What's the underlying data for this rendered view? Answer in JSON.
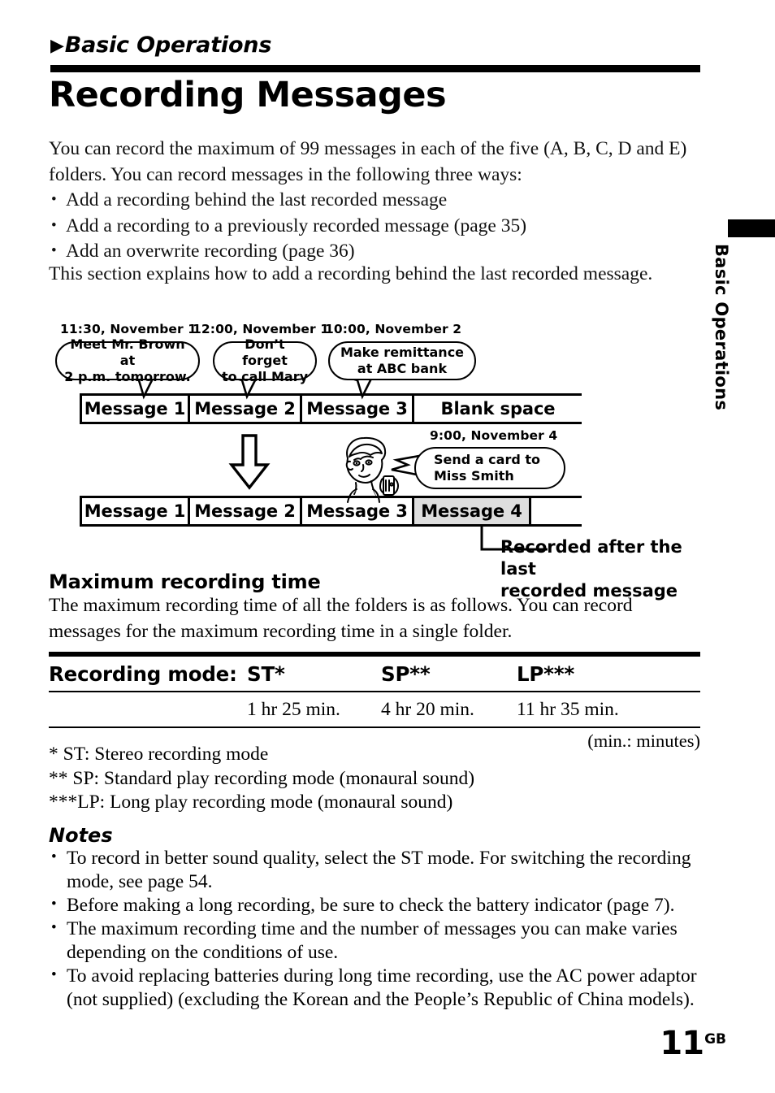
{
  "chapter": {
    "marker": "▶",
    "label": "Basic Operations"
  },
  "title": "Recording Messages",
  "side_tab": {
    "label": "Basic Operations"
  },
  "intro": {
    "paragraph": "You can record the maximum of 99 messages in each of the five (A, B, C, D and E) folders.  You can record messages in the following three ways:",
    "bullets": [
      "Add a recording behind the last recorded message",
      "Add a recording to a previously recorded message (page 35)",
      "Add an overwrite recording  (page 36)"
    ]
  },
  "section_intro": "This section explains how to add a recording behind the last recorded message.",
  "diagram": {
    "timestamps_top": [
      "11:30,  November 1",
      "12:00,  November 1",
      "10:00,  November 2"
    ],
    "bubbles_top": [
      "Meet Mr. Brown at\n2 p.m. tomorrow.",
      "Don’t forget\nto call Mary",
      "Make remittance\nat ABC bank"
    ],
    "strip_before": [
      "Message 1",
      "Message 2",
      "Message 3",
      "Blank space"
    ],
    "timestamp_new": "9:00, November 4",
    "bubble_new": "Send a card to\nMiss Smith",
    "strip_after": [
      "Message 1",
      "Message 2",
      "Message 3",
      "Message 4"
    ],
    "callout": "Recorded after the last\nrecorded message",
    "arrow_icon": "down-arrow",
    "person_icon": "person-with-recorder",
    "shaded_cell_color": "#dedede"
  },
  "max_recording": {
    "heading": "Maximum recording time",
    "paragraph": "The maximum recording time of all the folders is as follows.  You can record messages for the maximum recording time in a single folder.",
    "table": {
      "headers": [
        "Recording mode:",
        "ST*",
        "SP**",
        "LP***"
      ],
      "values": [
        "",
        "1 hr 25 min.",
        "4 hr 20 min.",
        "11 hr 35 min."
      ],
      "footer_note": "(min.: minutes)"
    }
  },
  "footnotes": [
    "* ST: Stereo recording mode",
    "** SP: Standard play recording mode (monaural sound)",
    "***LP: Long play recording mode (monaural sound)"
  ],
  "notes": {
    "heading": "Notes",
    "items": [
      "To record in better sound quality, select the ST mode.  For switching the recording mode, see page 54.",
      "Before making a long recording, be sure to check the battery indicator (page 7).",
      "The maximum recording time and the number of messages you can make varies depending on the conditions of use.",
      "To avoid replacing batteries during long time recording, use the AC power adaptor (not supplied) (excluding the Korean and the People’s Republic of China models)."
    ]
  },
  "page_number": {
    "number": "11",
    "suffix": "GB"
  }
}
